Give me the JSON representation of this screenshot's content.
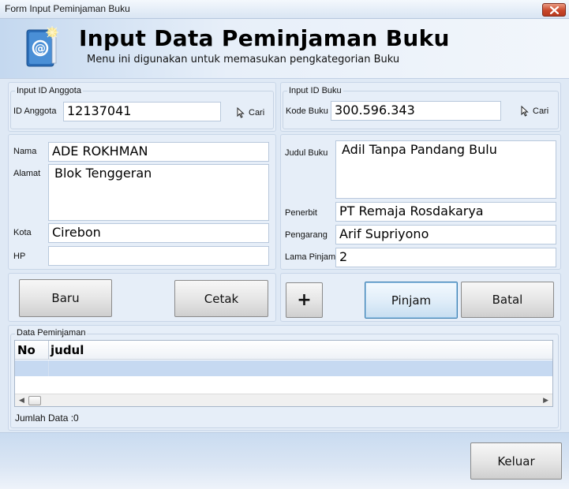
{
  "window": {
    "title": "Form Input Peminjaman Buku"
  },
  "header": {
    "title": "Input Data Peminjaman Buku",
    "subtitle": "Menu ini digunakan untuk memasukan pengkategorian Buku"
  },
  "anggota": {
    "group_title": "Input ID Anggota",
    "id_label": "ID Anggota",
    "id_value": "12137041",
    "cari_label": "Cari",
    "nama_label": "Nama",
    "nama_value": "ADE ROKHMAN",
    "alamat_label": "Alamat",
    "alamat_value": "Blok Tenggeran",
    "kota_label": "Kota",
    "kota_value": "Cirebon",
    "hp_label": "HP",
    "hp_value": ""
  },
  "buku": {
    "group_title": "Input ID Buku",
    "kode_label": "Kode Buku",
    "kode_value": "300.596.343",
    "cari_label": "Cari",
    "judul_label": "Judul Buku",
    "judul_value": "Adil Tanpa Pandang Bulu",
    "penerbit_label": "Penerbit",
    "penerbit_value": "PT Remaja Rosdakarya",
    "pengarang_label": "Pengarang",
    "pengarang_value": "Arif Supriyono",
    "lama_label": "Lama Pinjam",
    "lama_value": "2"
  },
  "buttons": {
    "baru": "Baru",
    "cetak": "Cetak",
    "plus": "+",
    "pinjam": "Pinjam",
    "batal": "Batal",
    "keluar": "Keluar"
  },
  "data_peminjaman": {
    "group_title": "Data Peminjaman",
    "columns": [
      "No",
      "judul"
    ],
    "rows": [],
    "count_text": "Jumlah Data :0"
  }
}
